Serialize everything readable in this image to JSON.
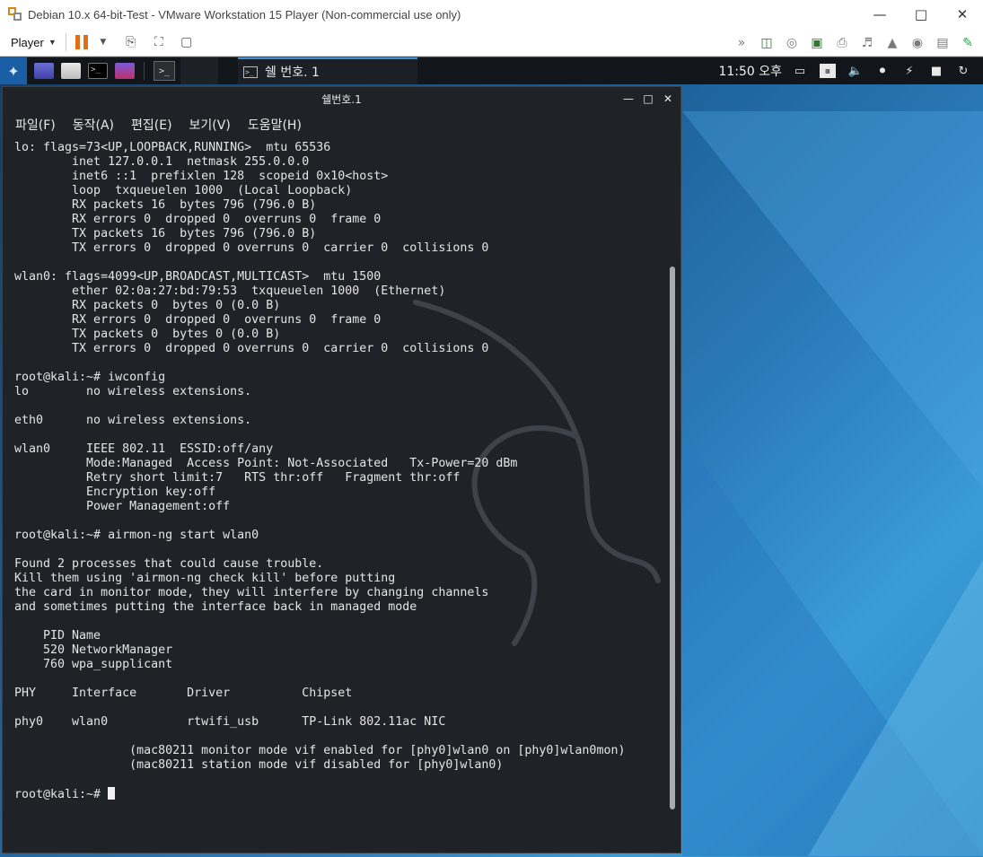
{
  "vmware": {
    "title": "Debian 10.x 64-bit-Test - VMware Workstation 15 Player (Non-commercial use only)",
    "player_menu": "Player"
  },
  "kali_panel": {
    "task_label": "쉘 번호. 1",
    "clock": "11:50 오후"
  },
  "terminal": {
    "title": "쉘번호.1",
    "menu": [
      "파일(F)",
      "동작(A)",
      "편집(E)",
      "보기(V)",
      "도움말(H)"
    ],
    "lines": [
      "lo: flags=73<UP,LOOPBACK,RUNNING>  mtu 65536",
      "        inet 127.0.0.1  netmask 255.0.0.0",
      "        inet6 ::1  prefixlen 128  scopeid 0x10<host>",
      "        loop  txqueuelen 1000  (Local Loopback)",
      "        RX packets 16  bytes 796 (796.0 B)",
      "        RX errors 0  dropped 0  overruns 0  frame 0",
      "        TX packets 16  bytes 796 (796.0 B)",
      "        TX errors 0  dropped 0 overruns 0  carrier 0  collisions 0",
      "",
      "wlan0: flags=4099<UP,BROADCAST,MULTICAST>  mtu 1500",
      "        ether 02:0a:27:bd:79:53  txqueuelen 1000  (Ethernet)",
      "        RX packets 0  bytes 0 (0.0 B)",
      "        RX errors 0  dropped 0  overruns 0  frame 0",
      "        TX packets 0  bytes 0 (0.0 B)",
      "        TX errors 0  dropped 0 overruns 0  carrier 0  collisions 0",
      "",
      "root@kali:~# iwconfig",
      "lo        no wireless extensions.",
      "",
      "eth0      no wireless extensions.",
      "",
      "wlan0     IEEE 802.11  ESSID:off/any",
      "          Mode:Managed  Access Point: Not-Associated   Tx-Power=20 dBm",
      "          Retry short limit:7   RTS thr:off   Fragment thr:off",
      "          Encryption key:off",
      "          Power Management:off",
      "",
      "root@kali:~# airmon-ng start wlan0",
      "",
      "Found 2 processes that could cause trouble.",
      "Kill them using 'airmon-ng check kill' before putting",
      "the card in monitor mode, they will interfere by changing channels",
      "and sometimes putting the interface back in managed mode",
      "",
      "    PID Name",
      "    520 NetworkManager",
      "    760 wpa_supplicant",
      "",
      "PHY     Interface       Driver          Chipset",
      "",
      "phy0    wlan0           rtwifi_usb      TP-Link 802.11ac NIC",
      "",
      "                (mac80211 monitor mode vif enabled for [phy0]wlan0 on [phy0]wlan0mon)",
      "                (mac80211 station mode vif disabled for [phy0]wlan0)",
      ""
    ],
    "prompt": "root@kali:~# "
  }
}
